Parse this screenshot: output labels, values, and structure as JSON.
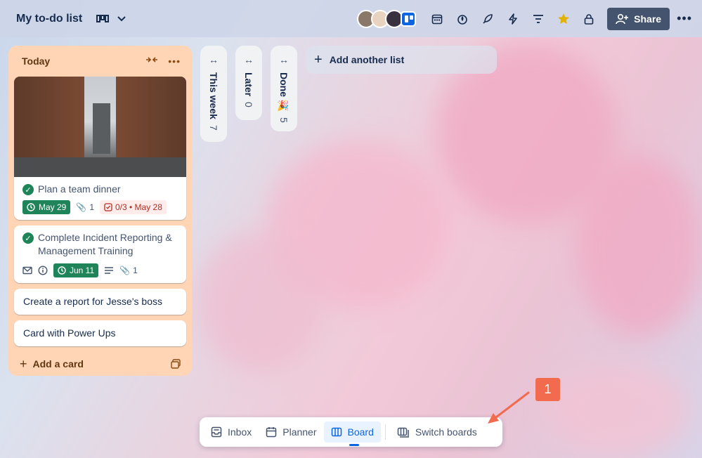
{
  "board": {
    "title": "My to-do list",
    "share_label": "Share",
    "more_label": "•••"
  },
  "lists": {
    "today": {
      "title": "Today",
      "cards": [
        {
          "title": "Plan a team dinner",
          "due": "May 29",
          "attachments": "1",
          "checklist": "0/3 • May 28"
        },
        {
          "title": "Complete Incident Reporting & Management Training",
          "due": "Jun 11",
          "attachments": "1"
        },
        {
          "title": "Create a report for Jesse's boss"
        },
        {
          "title": "Card with Power Ups"
        }
      ],
      "add_card_label": "Add a card"
    },
    "this_week": {
      "title": "This week",
      "count": "7"
    },
    "later": {
      "title": "Later",
      "count": "0"
    },
    "done": {
      "title": "Done 🎉",
      "count": "5"
    }
  },
  "add_list_label": "Add another list",
  "bottom_nav": {
    "inbox": "Inbox",
    "planner": "Planner",
    "board": "Board",
    "switch": "Switch boards"
  },
  "annotation": {
    "number": "1"
  },
  "colors": {
    "today_list_bg": "#ffd5b5",
    "date_green": "#1f845a",
    "share_btn": "#44546f",
    "accent_blue": "#0c66e4",
    "callout": "#f26b4e"
  }
}
